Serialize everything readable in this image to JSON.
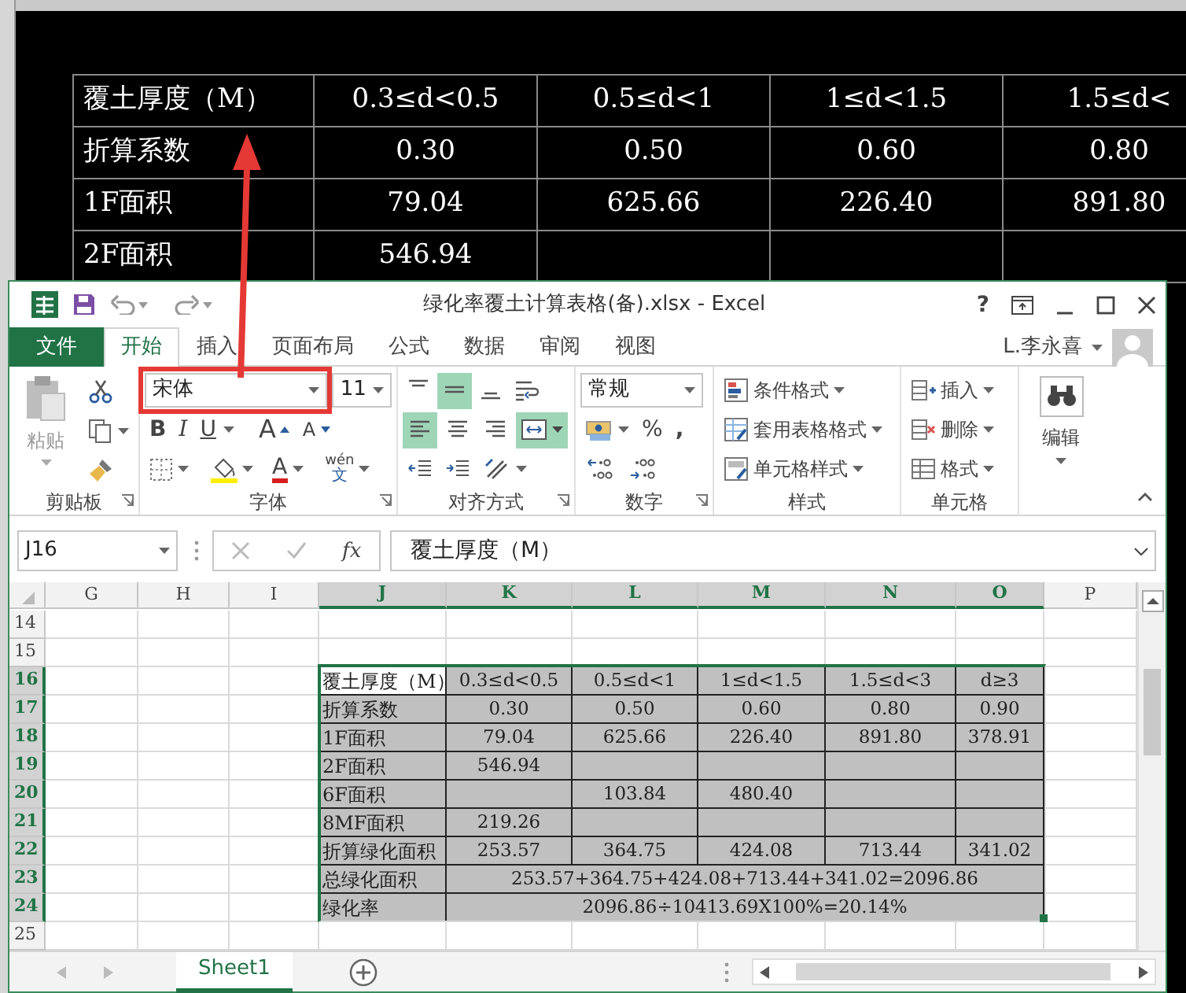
{
  "cad_table": {
    "rows": [
      [
        "覆土厚度（M）",
        "0.3≤d<0.5",
        "0.5≤d<1",
        "1≤d<1.5",
        "1.5≤d<"
      ],
      [
        "折算系数",
        "0.30",
        "0.50",
        "0.60",
        "0.80"
      ],
      [
        "1F面积",
        "79.04",
        "625.66",
        "226.40",
        "891.80"
      ],
      [
        "2F面积",
        "546.94",
        null,
        null,
        null
      ]
    ]
  },
  "excel": {
    "title": "绿化率覆土计算表格(备).xlsx - Excel",
    "help": "?",
    "tabs": [
      {
        "label": "文件",
        "kind": "file",
        "selected": false
      },
      {
        "label": "开始",
        "kind": "tab",
        "selected": true
      },
      {
        "label": "插入",
        "kind": "tab",
        "selected": false
      },
      {
        "label": "页面布局",
        "kind": "tab",
        "selected": false
      },
      {
        "label": "公式",
        "kind": "tab",
        "selected": false
      },
      {
        "label": "数据",
        "kind": "tab",
        "selected": false
      },
      {
        "label": "审阅",
        "kind": "tab",
        "selected": false
      },
      {
        "label": "视图",
        "kind": "tab",
        "selected": false
      }
    ],
    "user": "L.李永喜",
    "ribbon": {
      "clipboard": {
        "paste": "粘贴",
        "paste_disabled": true,
        "label": "剪贴板"
      },
      "font": {
        "name": "宋体",
        "size": "11",
        "bold": "B",
        "italic": "I",
        "underline": "U",
        "grow": "A",
        "shrink": "A",
        "font_color": "A",
        "phonetic_ruby": "wén",
        "phonetic_base": "文",
        "label": "字体"
      },
      "alignment": {
        "top": {
          "selected": false
        },
        "middle": {
          "selected": true
        },
        "bottom": {
          "selected": false
        },
        "left": {
          "selected": true
        },
        "center": {
          "selected": false
        },
        "right": {
          "selected": false
        },
        "merge": {
          "selected": true
        },
        "label": "对齐方式"
      },
      "number": {
        "format": "常规",
        "percent": "%",
        "comma": ",",
        "label": "数字"
      },
      "styles": {
        "items": [
          "条件格式",
          "套用表格格式",
          "单元格样式"
        ],
        "label": "样式"
      },
      "cells": {
        "items": [
          "插入",
          "删除",
          "格式"
        ],
        "label": "单元格"
      },
      "editing": {
        "label": "编辑"
      }
    },
    "formula_bar": {
      "name_box": "J16",
      "function": "fx",
      "formula": "覆土厚度（M）"
    },
    "sheet": {
      "columns": [
        {
          "label": "G",
          "selected": false
        },
        {
          "label": "H",
          "selected": false
        },
        {
          "label": "I",
          "selected": false
        },
        {
          "label": "J",
          "selected": true
        },
        {
          "label": "K",
          "selected": true
        },
        {
          "label": "L",
          "selected": true
        },
        {
          "label": "M",
          "selected": true
        },
        {
          "label": "N",
          "selected": true
        },
        {
          "label": "O",
          "selected": true
        },
        {
          "label": "P",
          "selected": false
        }
      ],
      "rows": [
        {
          "header": "14",
          "selected": false,
          "kind": "blank"
        },
        {
          "header": "15",
          "selected": false,
          "kind": "blank"
        },
        {
          "header": "16",
          "selected": true,
          "kind": "data",
          "cells": [
            {
              "text": "覆土厚度（M）",
              "selected": true
            },
            {
              "text": "0.3≤d<0.5",
              "selected": false
            },
            {
              "text": "0.5≤d<1",
              "selected": false
            },
            {
              "text": "1≤d<1.5",
              "selected": false
            },
            {
              "text": "1.5≤d<3",
              "selected": false
            },
            {
              "text": "d≥3",
              "selected": false
            }
          ]
        },
        {
          "header": "17",
          "selected": true,
          "kind": "data",
          "cells": [
            {
              "text": "折算系数",
              "selected": false
            },
            {
              "text": "0.30",
              "selected": false
            },
            {
              "text": "0.50",
              "selected": false
            },
            {
              "text": "0.60",
              "selected": false
            },
            {
              "text": "0.80",
              "selected": false
            },
            {
              "text": "0.90",
              "selected": false
            }
          ]
        },
        {
          "header": "18",
          "selected": true,
          "kind": "data",
          "cells": [
            {
              "text": "1F面积",
              "selected": false
            },
            {
              "text": "79.04",
              "selected": false
            },
            {
              "text": "625.66",
              "selected": false
            },
            {
              "text": "226.40",
              "selected": false
            },
            {
              "text": "891.80",
              "selected": false
            },
            {
              "text": "378.91",
              "selected": false
            }
          ]
        },
        {
          "header": "19",
          "selected": true,
          "kind": "data",
          "cells": [
            {
              "text": "2F面积",
              "selected": false
            },
            {
              "text": "546.94",
              "selected": false
            },
            {
              "selected": false
            },
            {
              "selected": false
            },
            {
              "selected": false
            },
            {
              "selected": false
            }
          ]
        },
        {
          "header": "20",
          "selected": true,
          "kind": "data",
          "cells": [
            {
              "text": "6F面积",
              "selected": false
            },
            {
              "selected": false
            },
            {
              "text": "103.84",
              "selected": false
            },
            {
              "text": "480.40",
              "selected": false
            },
            {
              "selected": false
            },
            {
              "selected": false
            }
          ]
        },
        {
          "header": "21",
          "selected": true,
          "kind": "data",
          "cells": [
            {
              "text": "8MF面积",
              "selected": false
            },
            {
              "text": "219.26",
              "selected": false
            },
            {
              "selected": false
            },
            {
              "selected": false
            },
            {
              "selected": false
            },
            {
              "selected": false
            }
          ]
        },
        {
          "header": "22",
          "selected": true,
          "kind": "data",
          "cells": [
            {
              "text": "折算绿化面积",
              "selected": false
            },
            {
              "text": "253.57",
              "selected": false
            },
            {
              "text": "364.75",
              "selected": false
            },
            {
              "text": "424.08",
              "selected": false
            },
            {
              "text": "713.44",
              "selected": false
            },
            {
              "text": "341.02",
              "selected": false
            }
          ]
        },
        {
          "header": "23",
          "selected": true,
          "kind": "merged",
          "cells": [
            {
              "text": "总绿化面积",
              "selected": false
            },
            {
              "text": "253.57+364.75+424.08+713.44+341.02=2096.86",
              "selected": false
            }
          ]
        },
        {
          "header": "24",
          "selected": true,
          "kind": "merged",
          "cells": [
            {
              "text": "绿化率",
              "selected": false
            },
            {
              "text": "2096.86÷10413.69X100%=20.14%",
              "selected": false
            }
          ]
        },
        {
          "header": "25",
          "selected": false,
          "kind": "blank"
        }
      ]
    },
    "sheet_tabs": [
      {
        "label": "Sheet1",
        "selected": true
      }
    ]
  }
}
